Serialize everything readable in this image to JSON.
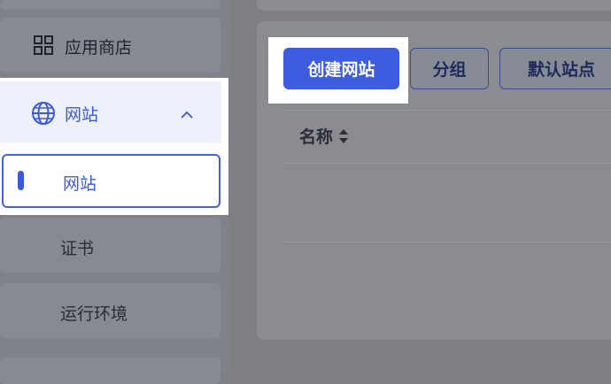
{
  "sidebar": {
    "app_store_label": "应用商店",
    "website_group_label": "网站",
    "items": [
      {
        "label": "网站"
      },
      {
        "label": "证书"
      },
      {
        "label": "运行环境"
      }
    ]
  },
  "toolbar": {
    "create_label": "创建网站",
    "group_label": "分组",
    "default_site_label": "默认站点"
  },
  "table": {
    "columns": [
      "名称"
    ]
  },
  "colors": {
    "primary": "#3d5ce0",
    "active_border": "#4262e0",
    "group_bg": "#eef1fb"
  }
}
